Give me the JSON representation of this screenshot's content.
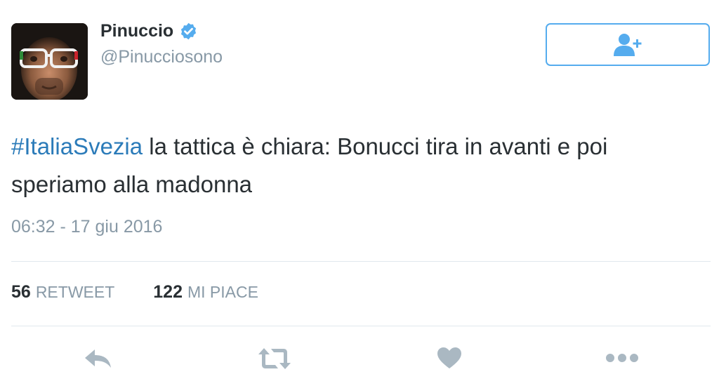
{
  "user": {
    "display_name": "Pinuccio",
    "handle": "@Pinucciosono",
    "verified": true
  },
  "follow_button": {
    "icon": "add-user-icon"
  },
  "tweet": {
    "hashtag": "#ItaliaSvezia",
    "text": " la tattica è chiara: Bonucci tira in avanti e poi speriamo alla madonna",
    "timestamp": "06:32 - 17 giu 2016"
  },
  "stats": {
    "retweets_count": "56",
    "retweets_label": "RETWEET",
    "likes_count": "122",
    "likes_label": "MI PIACE"
  },
  "actions": {
    "reply_icon": "reply-icon",
    "retweet_icon": "retweet-icon",
    "like_icon": "heart-icon",
    "more_icon": "more-icon"
  },
  "colors": {
    "accent": "#55acee",
    "link": "#2b7bb9",
    "muted": "#8899a6",
    "text": "#292f33",
    "icon": "#aab8c2",
    "divider": "#e1e8ed"
  }
}
